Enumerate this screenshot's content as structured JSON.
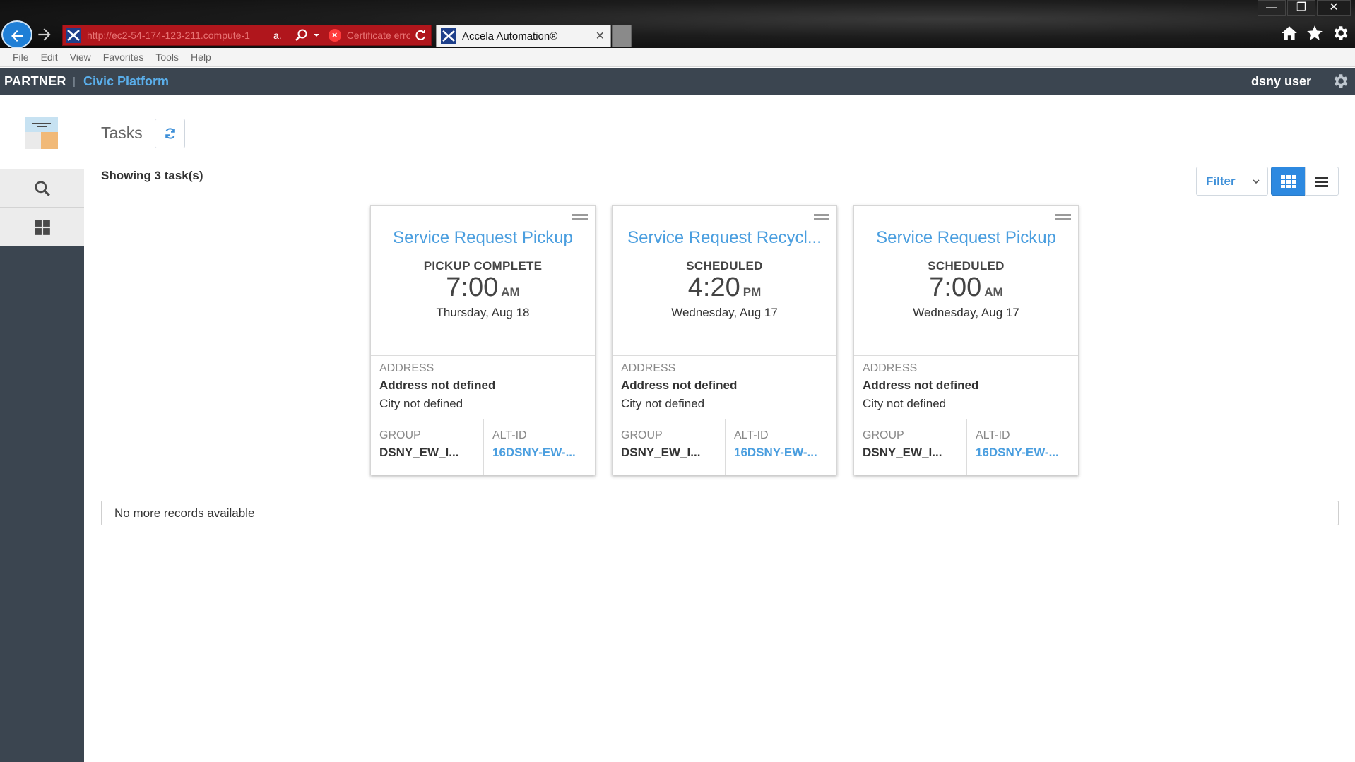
{
  "browser": {
    "window_controls": {
      "minimize": "—",
      "restore": "❐",
      "close": "✕"
    },
    "address_url": "http://ec2-54-174-123-211.compute-1",
    "address_suffix": "a.",
    "cert_text": "Certificate error",
    "active_tab_label": "Accela Automation®",
    "tab_close": "✕",
    "menu": [
      "File",
      "Edit",
      "View",
      "Favorites",
      "Tools",
      "Help"
    ],
    "colors": {
      "address_bar": "#b0161c",
      "back_button": "#1f7fd6"
    }
  },
  "header": {
    "brand": "PARTNER",
    "separator": "|",
    "product": "Civic Platform",
    "username": "dsny user"
  },
  "sidebar": {
    "items": [
      {
        "icon": "search-icon"
      },
      {
        "icon": "grid-icon"
      }
    ]
  },
  "main": {
    "title": "Tasks",
    "showing": "Showing 3 task(s)",
    "filter_label": "Filter",
    "view_modes": {
      "active": "grid",
      "other": "list"
    },
    "no_more": "No more records available"
  },
  "cards": [
    {
      "title": "Service Request Pickup",
      "status": "PICKUP COMPLETE",
      "time": "7:00",
      "ampm": "AM",
      "date": "Thursday, Aug 18",
      "address_label": "ADDRESS",
      "address": "Address not defined",
      "city": "City not defined",
      "group_label": "GROUP",
      "group": "DSNY_EW_I...",
      "alt_label": "ALT-ID",
      "alt_id": "16DSNY-EW-..."
    },
    {
      "title": "Service Request Recycl...",
      "status": "SCHEDULED",
      "time": "4:20",
      "ampm": "PM",
      "date": "Wednesday, Aug 17",
      "address_label": "ADDRESS",
      "address": "Address not defined",
      "city": "City not defined",
      "group_label": "GROUP",
      "group": "DSNY_EW_I...",
      "alt_label": "ALT-ID",
      "alt_id": "16DSNY-EW-..."
    },
    {
      "title": "Service Request Pickup",
      "status": "SCHEDULED",
      "time": "7:00",
      "ampm": "AM",
      "date": "Wednesday, Aug 17",
      "address_label": "ADDRESS",
      "address": "Address not defined",
      "city": "City not defined",
      "group_label": "GROUP",
      "group": "DSNY_EW_I...",
      "alt_label": "ALT-ID",
      "alt_id": "16DSNY-EW-..."
    }
  ]
}
